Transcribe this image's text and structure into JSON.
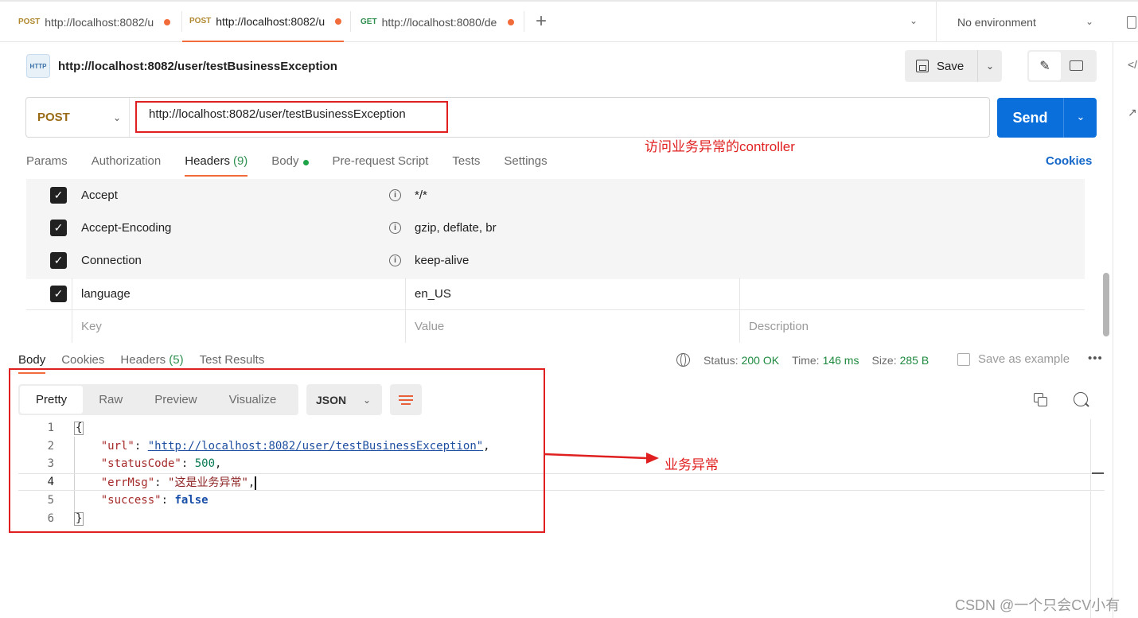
{
  "tabs": [
    {
      "method": "POST",
      "url": "http://localhost:8082/u",
      "unsaved": true
    },
    {
      "method": "POST",
      "url": "http://localhost:8082/u",
      "unsaved": true
    },
    {
      "method": "GET",
      "url": "http://localhost:8080/de",
      "unsaved": true
    }
  ],
  "environment": {
    "label": "No environment"
  },
  "request": {
    "badge": "HTTP",
    "title": "http://localhost:8082/user/testBusinessException",
    "method": "POST",
    "url": "http://localhost:8082/user/testBusinessException",
    "save_label": "Save",
    "send_label": "Send"
  },
  "annotations": {
    "url_note": "访问业务异常的controller",
    "response_note": "业务异常"
  },
  "request_tabs": {
    "params": "Params",
    "authorization": "Authorization",
    "headers": "Headers",
    "headers_count": "(9)",
    "body": "Body",
    "pre_request": "Pre-request Script",
    "tests": "Tests",
    "settings": "Settings",
    "cookies": "Cookies"
  },
  "headers": [
    {
      "key": "Accept",
      "value": "*/*",
      "auto": true
    },
    {
      "key": "Accept-Encoding",
      "value": "gzip, deflate, br",
      "auto": true
    },
    {
      "key": "Connection",
      "value": "keep-alive",
      "auto": true
    },
    {
      "key": "language",
      "value": "en_US",
      "auto": false
    }
  ],
  "headers_placeholder": {
    "key": "Key",
    "value": "Value",
    "description": "Description"
  },
  "response_tabs": {
    "body": "Body",
    "cookies": "Cookies",
    "headers": "Headers",
    "headers_count": "(5)",
    "test_results": "Test Results"
  },
  "response_status": {
    "status_label": "Status:",
    "status_value": "200 OK",
    "time_label": "Time:",
    "time_value": "146 ms",
    "size_label": "Size:",
    "size_value": "285 B",
    "save_example": "Save as example"
  },
  "response_views": {
    "pretty": "Pretty",
    "raw": "Raw",
    "preview": "Preview",
    "visualize": "Visualize",
    "format": "JSON"
  },
  "response_body": {
    "open": "{",
    "close": "}",
    "fields": [
      {
        "key": "\"url\"",
        "value": "\"http://localhost:8082/user/testBusinessException\"",
        "kind": "link"
      },
      {
        "key": "\"statusCode\"",
        "value": "500",
        "kind": "num"
      },
      {
        "key": "\"errMsg\"",
        "value": "\"这是业务异常\"",
        "kind": "str"
      },
      {
        "key": "\"success\"",
        "value": "false",
        "kind": "bool"
      }
    ],
    "line_numbers": [
      "1",
      "2",
      "3",
      "4",
      "5",
      "6"
    ]
  },
  "watermark": "CSDN @一个只会CV小有",
  "colors": {
    "accent": "#f26b3a",
    "send": "#0b6fdb",
    "annotation": "#e02020",
    "status_ok": "#1f8a3f"
  }
}
